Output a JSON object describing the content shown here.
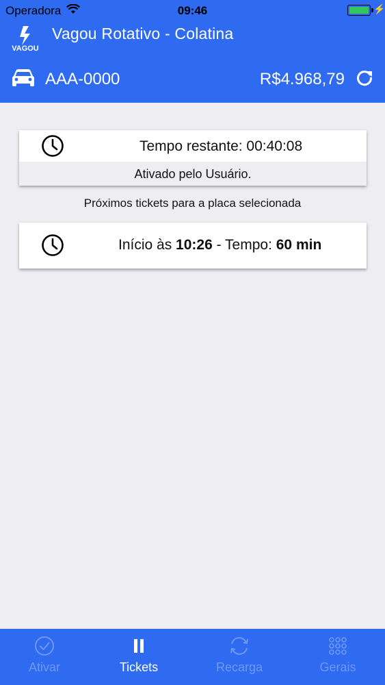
{
  "status_bar": {
    "carrier": "Operadora",
    "time": "09:46"
  },
  "header": {
    "logo_text": "VAGOU",
    "title": "Vagou Rotativo - Colatina",
    "plate": "AAA-0000",
    "balance": "R$4.968,79"
  },
  "current_ticket": {
    "remaining": "Tempo restante: 00:40:08",
    "activated_by": "Ativado pelo Usuário."
  },
  "next_tickets": {
    "label": "Próximos tickets para a placa selecionada",
    "items": [
      {
        "start_prefix": "Início às ",
        "start_time": "10:26",
        "duration_prefix": " - Tempo: ",
        "duration": "60 min"
      }
    ]
  },
  "tabs": [
    {
      "label": "Ativar",
      "icon": "check-circle-icon",
      "active": false
    },
    {
      "label": "Tickets",
      "icon": "pause-icon",
      "active": true
    },
    {
      "label": "Recarga",
      "icon": "refresh-icon",
      "active": false
    },
    {
      "label": "Gerais",
      "icon": "grid-icon",
      "active": false
    }
  ],
  "colors": {
    "primary": "#2f6bf0",
    "background": "#eeedf2",
    "tab_inactive": "#6f98f2"
  }
}
